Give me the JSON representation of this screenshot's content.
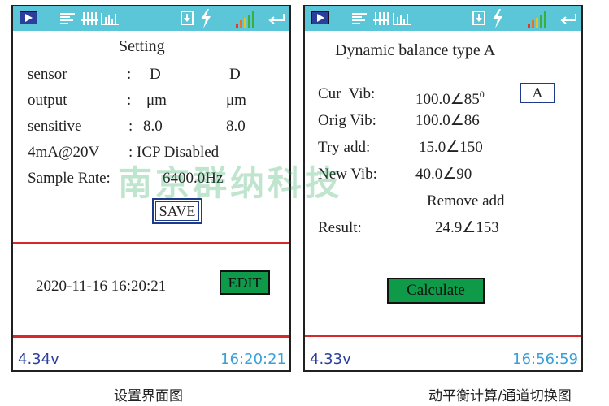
{
  "statusbar_icons": [
    "play-icon",
    "list-icon",
    "waveform-icon",
    "spectrum-bars-icon",
    "download-icon",
    "lightning-icon",
    "signal-strength-icon",
    "enter-return-icon"
  ],
  "colors": {
    "topbar": "#5bc6d8",
    "divider": "#d42a2a",
    "button_green": "#0f9a4a",
    "status_text": "#2a3f9c"
  },
  "setting": {
    "title": "Setting",
    "rows": [
      {
        "label": "sensor",
        "sep": ":",
        "val1": "D",
        "val2": "D"
      },
      {
        "label": "output",
        "sep": ":",
        "val1": "μm",
        "val2": "μm"
      },
      {
        "label": "sensitive",
        "sep": ":",
        "val1": "8.0",
        "val2": "8.0"
      }
    ],
    "icp_label": "4mA@20V",
    "icp_value": ": ICP Disabled",
    "sample_rate_label": "Sample Rate:",
    "sample_rate_value": "6400.0Hz",
    "save_label": "SAVE",
    "datetime": "2020-11-16 16:20:21",
    "edit_label": "EDIT",
    "voltage": "4.34v",
    "clock": "16:20:21"
  },
  "balance": {
    "title": "Dynamic balance type A",
    "cur_label": "Cur  Vib:",
    "cur_value": "100.0∠85",
    "cur_sup": "0",
    "channel_button": "A",
    "orig_label": "Orig Vib:",
    "orig_value": "100.0∠86",
    "try_label": "Try add:",
    "try_value": "15.0∠150",
    "new_label": "New Vib:",
    "new_value": "40.0∠90",
    "remove_label": "Remove add",
    "result_label": "Result:",
    "result_value": "24.9∠153",
    "calculate_label": "Calculate",
    "voltage": "4.33v",
    "clock": "16:56:59"
  },
  "watermark": "南京群纳科技",
  "captions": {
    "left": "设置界面图",
    "right": "动平衡计算/通道切换图"
  }
}
